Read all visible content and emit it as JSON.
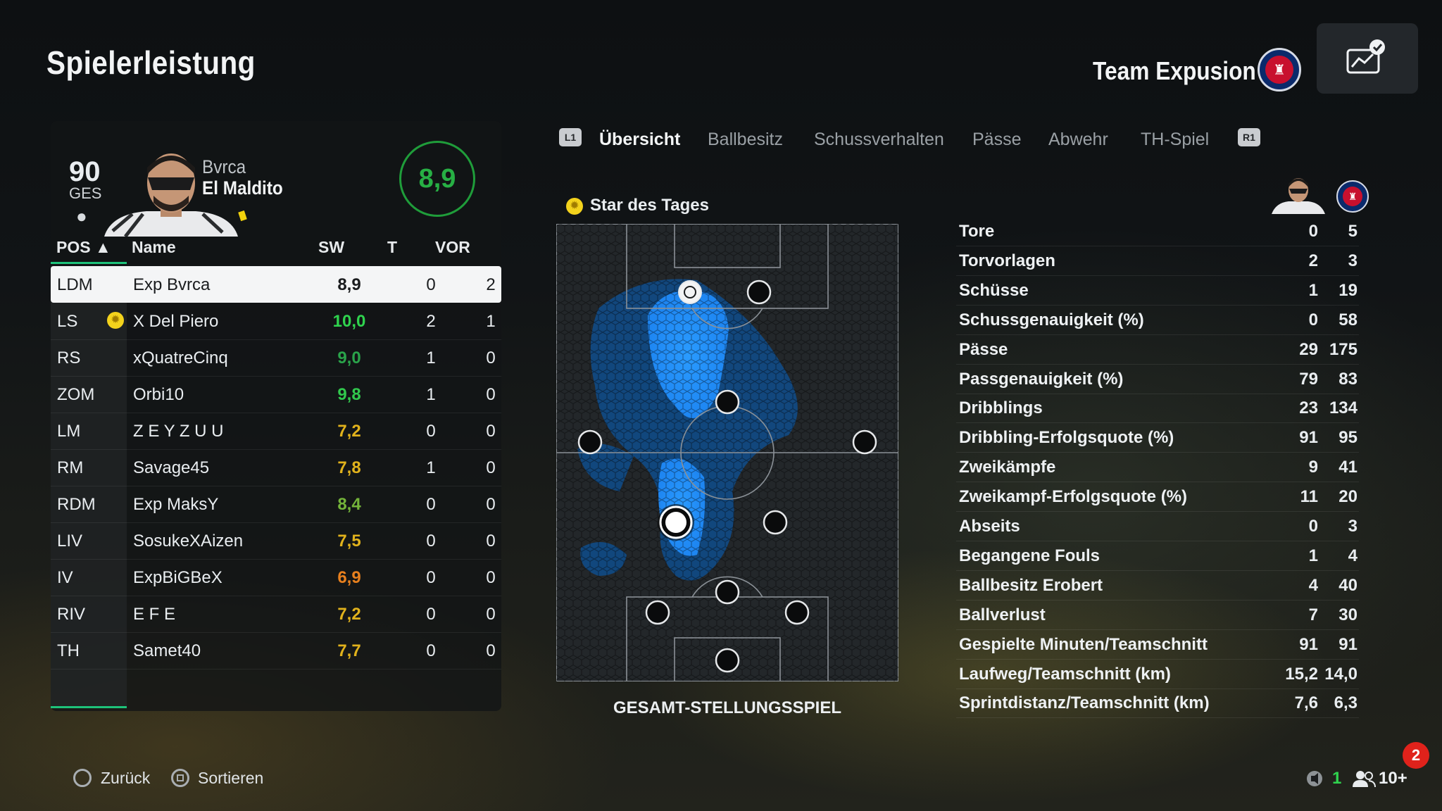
{
  "header": {
    "title": "Spielerleistung",
    "team_name": "Team Expusion"
  },
  "player_card": {
    "overall": "90",
    "overall_label": "GES",
    "name_line1": "Bvrca",
    "name_line2": "El Maldito",
    "rating": "8,9",
    "rating_color": "#27b044"
  },
  "table": {
    "headers": {
      "pos": "POS ▲",
      "name": "Name",
      "sw": "SW",
      "t": "T",
      "vor": "VOR"
    },
    "rows": [
      {
        "pos": "LDM",
        "name": "Exp Bvrca",
        "sw": "8,9",
        "t": "0",
        "vor": "2",
        "selected": true,
        "color": "#1a1c1e"
      },
      {
        "pos": "LS",
        "name": "X Del Piero",
        "sw": "10,0",
        "t": "2",
        "vor": "1",
        "star": true,
        "color": "#2fd34e"
      },
      {
        "pos": "RS",
        "name": "xQuatreCinq",
        "sw": "9,0",
        "t": "1",
        "vor": "0",
        "color": "#2aa34a"
      },
      {
        "pos": "ZOM",
        "name": "Orbi10",
        "sw": "9,8",
        "t": "1",
        "vor": "0",
        "color": "#31c84d"
      },
      {
        "pos": "LM",
        "name": "Z E Y Z U U",
        "sw": "7,2",
        "t": "0",
        "vor": "0",
        "color": "#e1b21c"
      },
      {
        "pos": "RM",
        "name": "Savage45",
        "sw": "7,8",
        "t": "1",
        "vor": "0",
        "color": "#e1b21c"
      },
      {
        "pos": "RDM",
        "name": "Exp MaksY",
        "sw": "8,4",
        "t": "0",
        "vor": "0",
        "color": "#74b43a"
      },
      {
        "pos": "LIV",
        "name": "SosukeXAizen",
        "sw": "7,5",
        "t": "0",
        "vor": "0",
        "color": "#e1b21c"
      },
      {
        "pos": "IV",
        "name": "ExpBiGBeX",
        "sw": "6,9",
        "t": "0",
        "vor": "0",
        "color": "#e8801e"
      },
      {
        "pos": "RIV",
        "name": "E F E",
        "sw": "7,2",
        "t": "0",
        "vor": "0",
        "color": "#e1b21c"
      },
      {
        "pos": "TH",
        "name": "Samet40",
        "sw": "7,7",
        "t": "0",
        "vor": "0",
        "color": "#e1b21c"
      }
    ]
  },
  "tabs": {
    "left_button": "L1",
    "right_button": "R1",
    "items": [
      {
        "label": "Übersicht",
        "active": true
      },
      {
        "label": "Ballbesitz"
      },
      {
        "label": "Schussverhalten"
      },
      {
        "label": "Pässe"
      },
      {
        "label": "Abwehr"
      },
      {
        "label": "TH-Spiel"
      }
    ]
  },
  "pitch": {
    "star_label": "Star des Tages",
    "caption": "GESAMT-STELLUNGSSPIEL"
  },
  "stats": [
    {
      "label": "Tore",
      "player": "0",
      "team": "5"
    },
    {
      "label": "Torvorlagen",
      "player": "2",
      "team": "3"
    },
    {
      "label": "Schüsse",
      "player": "1",
      "team": "19"
    },
    {
      "label": "Schussgenauigkeit (%)",
      "player": "0",
      "team": "58"
    },
    {
      "label": "Pässe",
      "player": "29",
      "team": "175"
    },
    {
      "label": "Passgenauigkeit (%)",
      "player": "79",
      "team": "83"
    },
    {
      "label": "Dribblings",
      "player": "23",
      "team": "134"
    },
    {
      "label": "Dribbling-Erfolgsquote (%)",
      "player": "91",
      "team": "95"
    },
    {
      "label": "Zweikämpfe",
      "player": "9",
      "team": "41"
    },
    {
      "label": "Zweikampf-Erfolgsquote (%)",
      "player": "11",
      "team": "20"
    },
    {
      "label": "Abseits",
      "player": "0",
      "team": "3"
    },
    {
      "label": "Begangene Fouls",
      "player": "1",
      "team": "4"
    },
    {
      "label": "Ballbesitz Erobert",
      "player": "4",
      "team": "40"
    },
    {
      "label": "Ballverlust",
      "player": "7",
      "team": "30"
    },
    {
      "label": "Gespielte Minuten/Teamschnitt",
      "player": "91",
      "team": "91"
    },
    {
      "label": "Laufweg/Teamschnitt (km)",
      "player": "15,2",
      "team": "14,0"
    },
    {
      "label": "Sprintdistanz/Teamschnitt (km)",
      "player": "7,6",
      "team": "6,3"
    }
  ],
  "footer": {
    "back_label": "Zurück",
    "sort_label": "Sortieren",
    "notification_count": "2",
    "mic_count": "1",
    "party_count": "10+"
  },
  "colors": {
    "accent": "#1ec27a",
    "heatmap": "#1e90ff"
  }
}
